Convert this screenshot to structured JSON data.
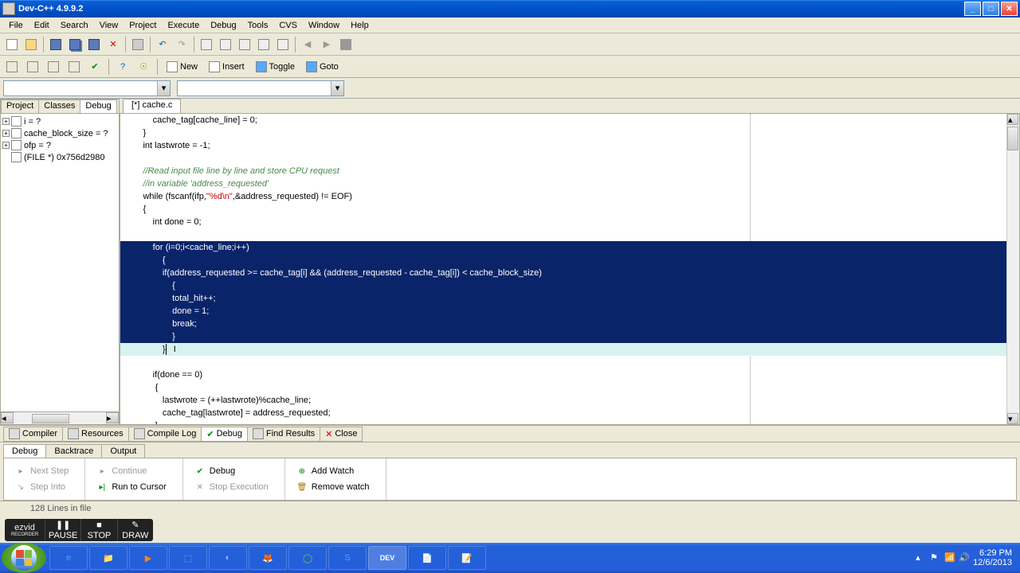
{
  "title": "Dev-C++ 4.9.9.2",
  "menu": [
    "File",
    "Edit",
    "Search",
    "View",
    "Project",
    "Execute",
    "Debug",
    "Tools",
    "CVS",
    "Window",
    "Help"
  ],
  "toolbar_text_btns": [
    "New",
    "Insert",
    "Toggle",
    "Goto"
  ],
  "sidebar": {
    "tabs": [
      "Project",
      "Classes",
      "Debug"
    ],
    "active": "Debug",
    "tree": [
      {
        "label": "i = ?"
      },
      {
        "label": "cache_block_size = ?"
      },
      {
        "label": "ofp = ?"
      },
      {
        "label": "(FILE *) 0x756d2980"
      }
    ]
  },
  "file_tab": "[*] cache.c",
  "code_lines": [
    {
      "text": "            cache_tag[cache_line] = 0;",
      "sel": false
    },
    {
      "text": "        }",
      "sel": false
    },
    {
      "text": "        int lastwrote = -1;",
      "sel": false
    },
    {
      "text": "",
      "sel": false
    },
    {
      "text": "        //Read input file line by line and store CPU request",
      "sel": false,
      "cmt": true
    },
    {
      "text": "        //in variable 'address_requested'",
      "sel": false,
      "cmt": true
    },
    {
      "text": "        while (fscanf(ifp,\"%d\\n\",&address_requested) != EOF)",
      "sel": false,
      "str": true
    },
    {
      "text": "        {",
      "sel": false
    },
    {
      "text": "            int done = 0;",
      "sel": false
    },
    {
      "text": "",
      "sel": false
    },
    {
      "text": "            for (i=0;i<cache_line;i++)",
      "sel": true
    },
    {
      "text": "                {",
      "sel": true
    },
    {
      "text": "                if(address_requested >= cache_tag[i] && (address_requested - cache_tag[i]) < cache_block_size)",
      "sel": true
    },
    {
      "text": "                    {",
      "sel": true
    },
    {
      "text": "                    total_hit++;",
      "sel": true
    },
    {
      "text": "                    done = 1;",
      "sel": true
    },
    {
      "text": "                    break;",
      "sel": true
    },
    {
      "text": "                    }",
      "sel": true
    },
    {
      "text": "                }",
      "sel": false,
      "caret": true
    },
    {
      "text": "",
      "sel": false
    },
    {
      "text": "            if(done == 0)",
      "sel": false
    },
    {
      "text": "             {",
      "sel": false
    },
    {
      "text": "                lastwrote = (++lastwrote)%cache_line;",
      "sel": false
    },
    {
      "text": "                cache_tag[lastwrote] = address_requested;",
      "sel": false
    },
    {
      "text": "             }",
      "sel": false
    }
  ],
  "bottom_tabs": [
    "Compiler",
    "Resources",
    "Compile Log",
    "Debug",
    "Find Results",
    "Close"
  ],
  "bottom_active": "Debug",
  "debug_sub_tabs": [
    "Debug",
    "Backtrace",
    "Output"
  ],
  "debug_sub_active": "Debug",
  "debug_buttons": {
    "col1": [
      {
        "label": "Next Step",
        "dis": true
      },
      {
        "label": "Step Into",
        "dis": true
      }
    ],
    "col2": [
      {
        "label": "Continue",
        "dis": true
      },
      {
        "label": "Run to Cursor",
        "dis": false
      }
    ],
    "col3": [
      {
        "label": "Debug",
        "dis": false
      },
      {
        "label": "Stop Execution",
        "dis": true
      }
    ],
    "col4": [
      {
        "label": "Add Watch",
        "dis": false
      },
      {
        "label": "Remove watch",
        "dis": false
      }
    ]
  },
  "status": {
    "lines": "128 Lines in file"
  },
  "recorder": {
    "logo": "ezvid",
    "sub": "RECORDER",
    "btns": [
      "PAUSE",
      "STOP",
      "DRAW"
    ]
  },
  "time": "6:29 PM",
  "date": "12/6/2013"
}
